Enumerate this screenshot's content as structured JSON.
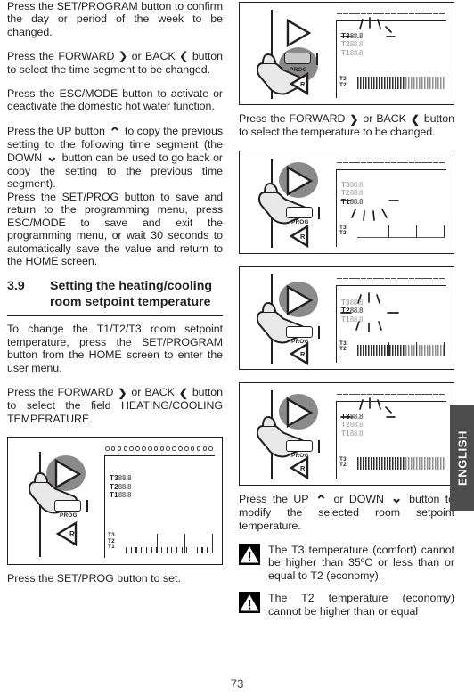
{
  "document": {
    "page_number": "73",
    "side_tab": "ENGLISH"
  },
  "left_column": {
    "paragraphs": [
      "Press the SET/PROGRAM button to confirm the day or period of the week to be changed.",
      "Press the FORWARD ❯ or BACK ❮ button to select the  time segment to be changed.",
      "Press the ESC/MODE button to activate or deactivate the domestic hot water function."
    ],
    "p_up_copy_pre": "Press the UP button ",
    "p_up_copy_mid": " to copy the previous setting to the following time segment (the DOWN ",
    "p_up_copy_post": " button can be used to go back or copy the setting to the previous time segment).",
    "p_save": "Press the SET/PROG button to save and return to the programming menu, press ESC/MODE to save and exit the programming menu, or wait 30 seconds to automatically save the value and return to the HOME screen.",
    "section": {
      "number": "3.9",
      "title": "Setting the heating/cooling room setpoint temperature"
    },
    "p_change": "To change the T1/T2/T3 room setpoint temperature, press the SET/PROGRAM button from the HOME screen to enter the user menu.",
    "p_forward_pre": "Press the FORWARD ",
    "p_forward_mid": " or BACK ",
    "p_forward_post": " button to select the field HEATING/COOLING TEMPERATURE.",
    "figure_caption": "Press the SET/PROG button to set."
  },
  "right_column": {
    "p_forward_pre": "Press the FORWARD ",
    "p_forward_mid": " or BACK ",
    "p_forward_post": " button to select the temperature to be changed.",
    "p_updown_pre": "Press the UP ",
    "p_updown_mid": " or DOWN ",
    "p_updown_post": " button to modify the selected room setpoint temperature.",
    "warnings": [
      "The T3 temperature (comfort) cannot be higher than 35ºC or less than or equal to T2 (economy).",
      "The T2 temperature (economy) cannot be higher than or equal"
    ]
  },
  "figures": {
    "display_labels": {
      "t3": "T3",
      "t2": "T2",
      "t1": "T1",
      "value": "88.8"
    },
    "button_label": "PROG",
    "mode_label": "R"
  }
}
